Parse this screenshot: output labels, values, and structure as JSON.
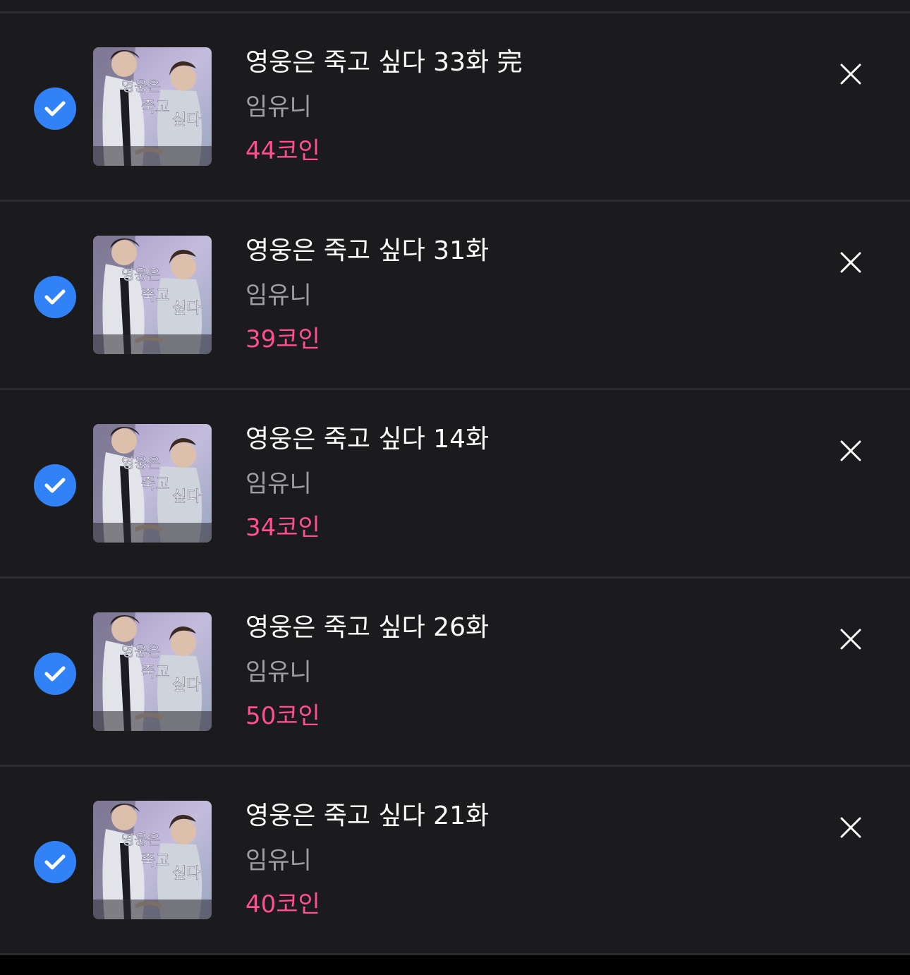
{
  "colors": {
    "background": "#1b1b1d",
    "divider": "#2c2c2e",
    "check_blue": "#3182f6",
    "title": "#ffffff",
    "author": "#9e9ea4",
    "price": "#ff4f8e"
  },
  "items": [
    {
      "title": "영웅은 죽고 싶다 33화 完",
      "author": "임유니",
      "price": "44코인",
      "checked": true,
      "cover_text": "영웅은 죽고 싶다"
    },
    {
      "title": "영웅은 죽고 싶다 31화",
      "author": "임유니",
      "price": "39코인",
      "checked": true,
      "cover_text": "영웅은 죽고 싶다"
    },
    {
      "title": "영웅은 죽고 싶다 14화",
      "author": "임유니",
      "price": "34코인",
      "checked": true,
      "cover_text": "영웅은 죽고 싶다"
    },
    {
      "title": "영웅은 죽고 싶다 26화",
      "author": "임유니",
      "price": "50코인",
      "checked": true,
      "cover_text": "영웅은 죽고 싶다"
    },
    {
      "title": "영웅은 죽고 싶다 21화",
      "author": "임유니",
      "price": "40코인",
      "checked": true,
      "cover_text": "영웅은 죽고 싶다"
    }
  ],
  "icons": {
    "check": "check-icon",
    "close": "close-icon"
  }
}
